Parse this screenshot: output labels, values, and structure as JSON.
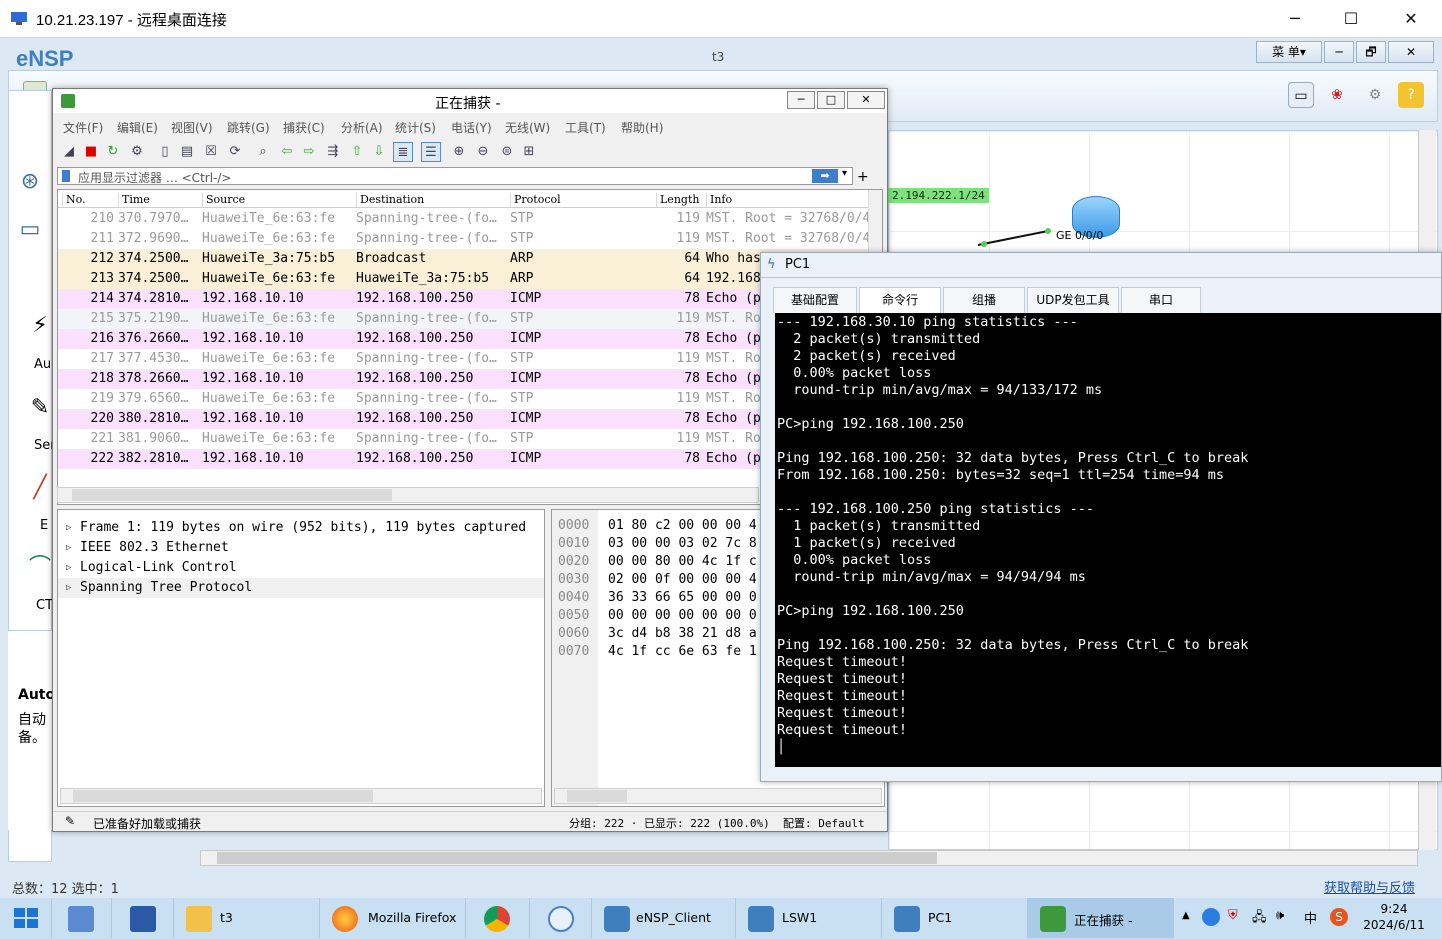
{
  "rdp": {
    "title": "10.21.23.197 - 远程桌面连接",
    "minimize": "─",
    "maximize": "☐",
    "close": "✕"
  },
  "ensp": {
    "title": "eNSP",
    "window_title": "t3",
    "menu_btn": "菜 单▾",
    "min_btn": "─",
    "restore_btn": "🗗",
    "close_btn": "✕",
    "devices": [
      {
        "icon": "router-icon",
        "label": "Au"
      },
      {
        "icon": "cable-icon",
        "label": "Ser"
      },
      {
        "icon": "ethernet-cable-icon",
        "label": "E"
      },
      {
        "icon": "ct-cable-icon",
        "label": "CT"
      }
    ],
    "auto_title": "Auto",
    "auto_desc1": "自动",
    "auto_desc2": "备。",
    "topology_ip": "2.194.222.1/24",
    "topology_port": "GE 0/0/0",
    "status_left": "总数：12  选中：1",
    "status_right": "获取帮助与反馈"
  },
  "wireshark": {
    "title": "正在捕获 -",
    "menus": [
      "文件(F)",
      "编辑(E)",
      "视图(V)",
      "跳转(G)",
      "捕获(C)",
      "分析(A)",
      "统计(S)",
      "电话(Y)",
      "无线(W)",
      "工具(T)",
      "帮助(H)"
    ],
    "filter_placeholder": "应用显示过滤器 … <Ctrl-/>",
    "filter_arrow": "➡",
    "filter_plus": "+",
    "columns": [
      "No.",
      "Time",
      "Source",
      "Destination",
      "Protocol",
      "Length",
      "Info"
    ],
    "packets": [
      {
        "no": "210",
        "time": "370.7970…",
        "src": "HuaweiTe_6e:63:fe",
        "dst": "Spanning-tree-(fo…",
        "proto": "STP",
        "len": "119",
        "info": "MST. Root = 32768/0/4",
        "kind": "stp"
      },
      {
        "no": "211",
        "time": "372.9690…",
        "src": "HuaweiTe_6e:63:fe",
        "dst": "Spanning-tree-(fo…",
        "proto": "STP",
        "len": "119",
        "info": "MST. Root = 32768/0/4",
        "kind": "stp"
      },
      {
        "no": "212",
        "time": "374.2500…",
        "src": "HuaweiTe_3a:75:b5",
        "dst": "Broadcast",
        "proto": "ARP",
        "len": "64",
        "info": "Who has",
        "kind": "arp"
      },
      {
        "no": "213",
        "time": "374.2500…",
        "src": "HuaweiTe_6e:63:fe",
        "dst": "HuaweiTe_3a:75:b5",
        "proto": "ARP",
        "len": "64",
        "info": "192.168",
        "kind": "arp"
      },
      {
        "no": "214",
        "time": "374.2810…",
        "src": "192.168.10.10",
        "dst": "192.168.100.250",
        "proto": "ICMP",
        "len": "78",
        "info": "Echo (p",
        "kind": "icmp"
      },
      {
        "no": "215",
        "time": "375.2190…",
        "src": "HuaweiTe_6e:63:fe",
        "dst": "Spanning-tree-(fo…",
        "proto": "STP",
        "len": "119",
        "info": "MST. Ro",
        "kind": "stpsel"
      },
      {
        "no": "216",
        "time": "376.2660…",
        "src": "192.168.10.10",
        "dst": "192.168.100.250",
        "proto": "ICMP",
        "len": "78",
        "info": "Echo (p",
        "kind": "icmp"
      },
      {
        "no": "217",
        "time": "377.4530…",
        "src": "HuaweiTe_6e:63:fe",
        "dst": "Spanning-tree-(fo…",
        "proto": "STP",
        "len": "119",
        "info": "MST. Ro",
        "kind": "stp"
      },
      {
        "no": "218",
        "time": "378.2660…",
        "src": "192.168.10.10",
        "dst": "192.168.100.250",
        "proto": "ICMP",
        "len": "78",
        "info": "Echo (p",
        "kind": "icmp"
      },
      {
        "no": "219",
        "time": "379.6560…",
        "src": "HuaweiTe_6e:63:fe",
        "dst": "Spanning-tree-(fo…",
        "proto": "STP",
        "len": "119",
        "info": "MST. Ro",
        "kind": "stp"
      },
      {
        "no": "220",
        "time": "380.2810…",
        "src": "192.168.10.10",
        "dst": "192.168.100.250",
        "proto": "ICMP",
        "len": "78",
        "info": "Echo (p",
        "kind": "icmp"
      },
      {
        "no": "221",
        "time": "381.9060…",
        "src": "HuaweiTe_6e:63:fe",
        "dst": "Spanning-tree-(fo…",
        "proto": "STP",
        "len": "119",
        "info": "MST. Ro",
        "kind": "stp"
      },
      {
        "no": "222",
        "time": "382.2810…",
        "src": "192.168.10.10",
        "dst": "192.168.100.250",
        "proto": "ICMP",
        "len": "78",
        "info": "Echo (p",
        "kind": "icmp"
      }
    ],
    "row_colors": {
      "stp": "#ffffff",
      "stpsel": "#f2f4f8",
      "arp": "#faf0d7",
      "icmp": "#fce0ff"
    },
    "details": [
      "Frame 1: 119 bytes on wire (952 bits), 119 bytes captured",
      "IEEE 802.3 Ethernet",
      "Logical-Link Control",
      "Spanning Tree Protocol"
    ],
    "bytes": [
      {
        "off": "0000",
        "hex": "01 80 c2 00 00 00 4"
      },
      {
        "off": "0010",
        "hex": "03 00 00 03 02 7c 8"
      },
      {
        "off": "0020",
        "hex": "00 00 80 00 4c 1f c"
      },
      {
        "off": "0030",
        "hex": "02 00 0f 00 00 00 4"
      },
      {
        "off": "0040",
        "hex": "36 33 66 65 00 00 0"
      },
      {
        "off": "0050",
        "hex": "00 00 00 00 00 00 0"
      },
      {
        "off": "0060",
        "hex": "3c d4 b8 38 21 d8 a"
      },
      {
        "off": "0070",
        "hex": "4c 1f cc 6e 63 fe 1"
      }
    ],
    "status_ready": "已准备好加载或捕获",
    "status_packets": "分组: 222 · 已显示: 222 (100.0%)",
    "status_profile": "配置: Default"
  },
  "pc1": {
    "title": "PC1",
    "tabs": [
      "基础配置",
      "命令行",
      "组播",
      "UDP发包工具",
      "串口"
    ],
    "active_tab": 1,
    "terminal": [
      "--- 192.168.30.10 ping statistics ---",
      "  2 packet(s) transmitted",
      "  2 packet(s) received",
      "  0.00% packet loss",
      "  round-trip min/avg/max = 94/133/172 ms",
      "",
      "PC>ping 192.168.100.250",
      "",
      "Ping 192.168.100.250: 32 data bytes, Press Ctrl_C to break",
      "From 192.168.100.250: bytes=32 seq=1 ttl=254 time=94 ms",
      "",
      "--- 192.168.100.250 ping statistics ---",
      "  1 packet(s) transmitted",
      "  1 packet(s) received",
      "  0.00% packet loss",
      "  round-trip min/avg/max = 94/94/94 ms",
      "",
      "PC>ping 192.168.100.250",
      "",
      "Ping 192.168.100.250: 32 data bytes, Press Ctrl_C to break",
      "Request timeout!",
      "Request timeout!",
      "Request timeout!",
      "Request timeout!",
      "Request timeout!"
    ]
  },
  "taskbar": {
    "items": [
      {
        "label": "",
        "icon": "windows-start-icon"
      },
      {
        "label": "",
        "icon": "server-manager-icon"
      },
      {
        "label": "",
        "icon": "powershell-icon"
      },
      {
        "label": "t3",
        "icon": "folder-icon"
      },
      {
        "label": "Mozilla Firefox",
        "icon": "firefox-icon"
      },
      {
        "label": "",
        "icon": "chrome-icon"
      },
      {
        "label": "",
        "icon": "app-icon"
      },
      {
        "label": "eNSP_Client",
        "icon": "ensp-icon"
      },
      {
        "label": "LSW1",
        "icon": "ensp-icon"
      },
      {
        "label": "PC1",
        "icon": "ensp-icon"
      },
      {
        "label": "正在捕获 -",
        "icon": "wireshark-icon"
      }
    ],
    "tray_ime": "中",
    "time": "9:24",
    "date": "2024/6/11"
  }
}
